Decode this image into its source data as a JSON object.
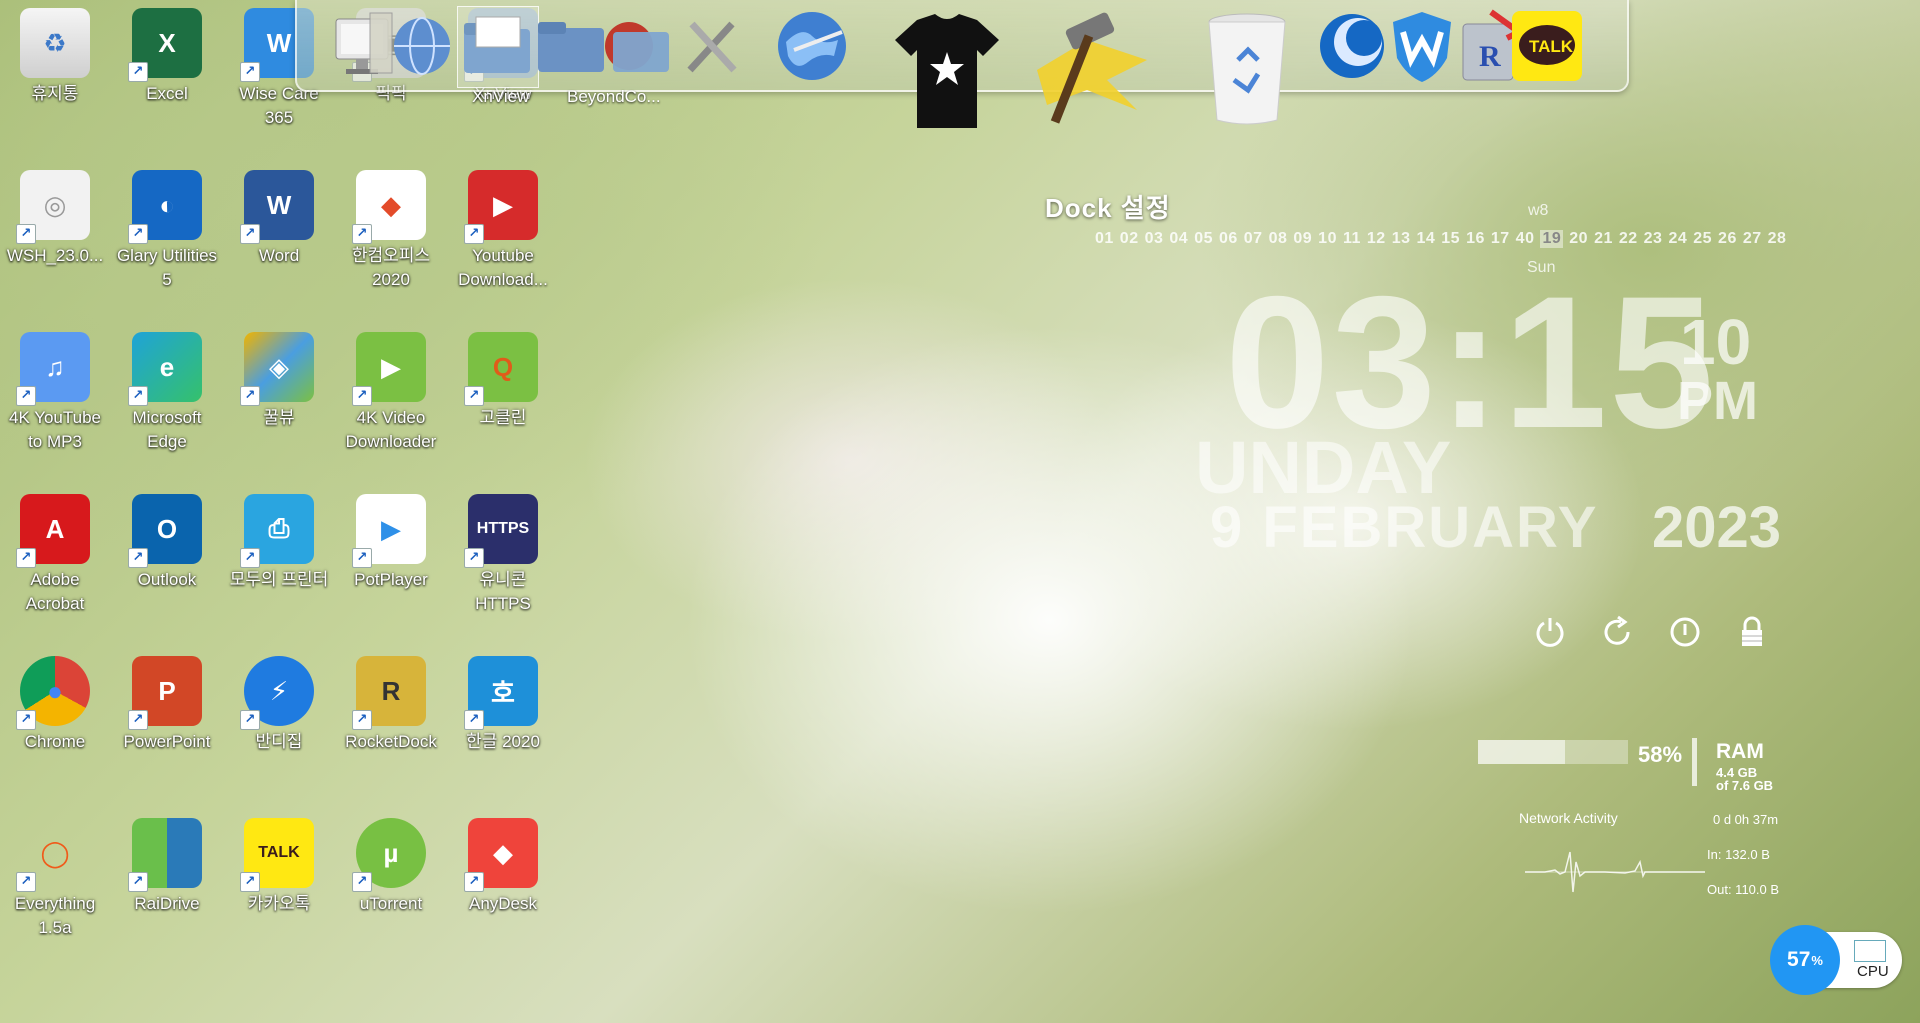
{
  "desktop_icons": [
    {
      "label": "휴지통",
      "icon": "recycle-bin-icon"
    },
    {
      "label": "Excel",
      "icon": "excel-icon"
    },
    {
      "label": "Wise Care 365",
      "icon": "wise-care-icon"
    },
    {
      "label": "픽픽",
      "icon": "picpick-icon"
    },
    {
      "label": "XnView",
      "icon": "xnview-icon"
    },
    {
      "label": "WSH_23.0...",
      "icon": "cd-disc-icon"
    },
    {
      "label": "Glary Utilities 5",
      "icon": "glary-icon"
    },
    {
      "label": "Word",
      "icon": "word-icon"
    },
    {
      "label": "한컴오피스 2020",
      "icon": "hancom-office-icon"
    },
    {
      "label": "Youtube Download...",
      "icon": "youtube-downloader-icon"
    },
    {
      "label": "4K YouTube to MP3",
      "icon": "4k-mp3-icon"
    },
    {
      "label": "Microsoft Edge",
      "icon": "edge-icon"
    },
    {
      "label": "꿀뷰",
      "icon": "honeyview-icon"
    },
    {
      "label": "4K Video Downloader",
      "icon": "4k-video-icon"
    },
    {
      "label": "고클린",
      "icon": "goclean-icon"
    },
    {
      "label": "Adobe Acrobat",
      "icon": "acrobat-icon"
    },
    {
      "label": "Outlook",
      "icon": "outlook-icon"
    },
    {
      "label": "모두의 프린터",
      "icon": "modu-printer-icon"
    },
    {
      "label": "PotPlayer",
      "icon": "potplayer-icon"
    },
    {
      "label": "유니콘 HTTPS",
      "icon": "unicorn-https-icon"
    },
    {
      "label": "Chrome",
      "icon": "chrome-icon"
    },
    {
      "label": "PowerPoint",
      "icon": "powerpoint-icon"
    },
    {
      "label": "반디집",
      "icon": "bandizip-icon"
    },
    {
      "label": "RocketDock",
      "icon": "rocketdock-icon"
    },
    {
      "label": "한글 2020",
      "icon": "hangul-icon"
    },
    {
      "label": "Everything 1.5a",
      "icon": "everything-icon"
    },
    {
      "label": "RaiDrive",
      "icon": "raidrive-icon"
    },
    {
      "label": "카카오톡",
      "icon": "kakaotalk-icon"
    },
    {
      "label": "uTorrent",
      "icon": "utorrent-icon"
    },
    {
      "label": "AnyDesk",
      "icon": "anydesk-icon"
    }
  ],
  "dock": {
    "items": [
      {
        "icon": "monitor-icon"
      },
      {
        "icon": "globe-icon"
      },
      {
        "icon": "folder-xnview-icon"
      },
      {
        "icon": "folder-icon"
      },
      {
        "icon": "beyondcompare-folder-icon"
      },
      {
        "icon": "tools-icon"
      },
      {
        "icon": "internet-globe-icon"
      },
      {
        "icon": "tshirt-icon"
      },
      {
        "icon": "hammer-icon"
      },
      {
        "icon": "recycle-bin-icon"
      },
      {
        "icon": "glary-icon"
      },
      {
        "icon": "wise-care-icon"
      },
      {
        "icon": "rocketdock-icon"
      },
      {
        "icon": "kakaotalk-icon"
      }
    ],
    "label_xnview": "XnView",
    "label_beyondcompare": "BeyondCo...",
    "settings_tooltip": "Dock 설정",
    "kakao_text": "TALK"
  },
  "calendar": {
    "week": "w8",
    "days": [
      "01",
      "02",
      "03",
      "04",
      "05",
      "06",
      "07",
      "08",
      "09",
      "10",
      "11",
      "12",
      "13",
      "14",
      "15",
      "16",
      "17",
      "40",
      "19",
      "20",
      "21",
      "22",
      "23",
      "24",
      "25",
      "26",
      "27",
      "28"
    ],
    "today_index": 18,
    "month_num": "02",
    "day_name": "Sun"
  },
  "clock": {
    "time": "03:15",
    "seconds": "10",
    "ampm": "PM",
    "weekday": "UNDAY",
    "date": "9 FEBRUARY",
    "year": "2023"
  },
  "power_buttons": [
    "power-icon",
    "restart-icon",
    "logoff-icon",
    "lock-icon"
  ],
  "system": {
    "ram_percent": "58%",
    "ram_fill": 0.58,
    "ram_label": "RAM",
    "ram_used": "4.4 GB",
    "ram_total": "of 7.6 GB",
    "uptime": "0 d 0h 37m",
    "network_title": "Network Activity",
    "net_in": "In: 132.0 B",
    "net_out": "Out: 110.0 B"
  },
  "cpu": {
    "percent": "57",
    "unit": "%",
    "label": "CPU"
  },
  "colors": {
    "excel": "#1d6f42",
    "word": "#2b579a",
    "powerpoint": "#d24726",
    "outlook": "#0a64ad",
    "acrobat": "#d7191c",
    "kakao": "#ffe812",
    "anydesk": "#ef443b",
    "hangul": "#1e90d9",
    "cpu_circle": "#2196f3"
  }
}
